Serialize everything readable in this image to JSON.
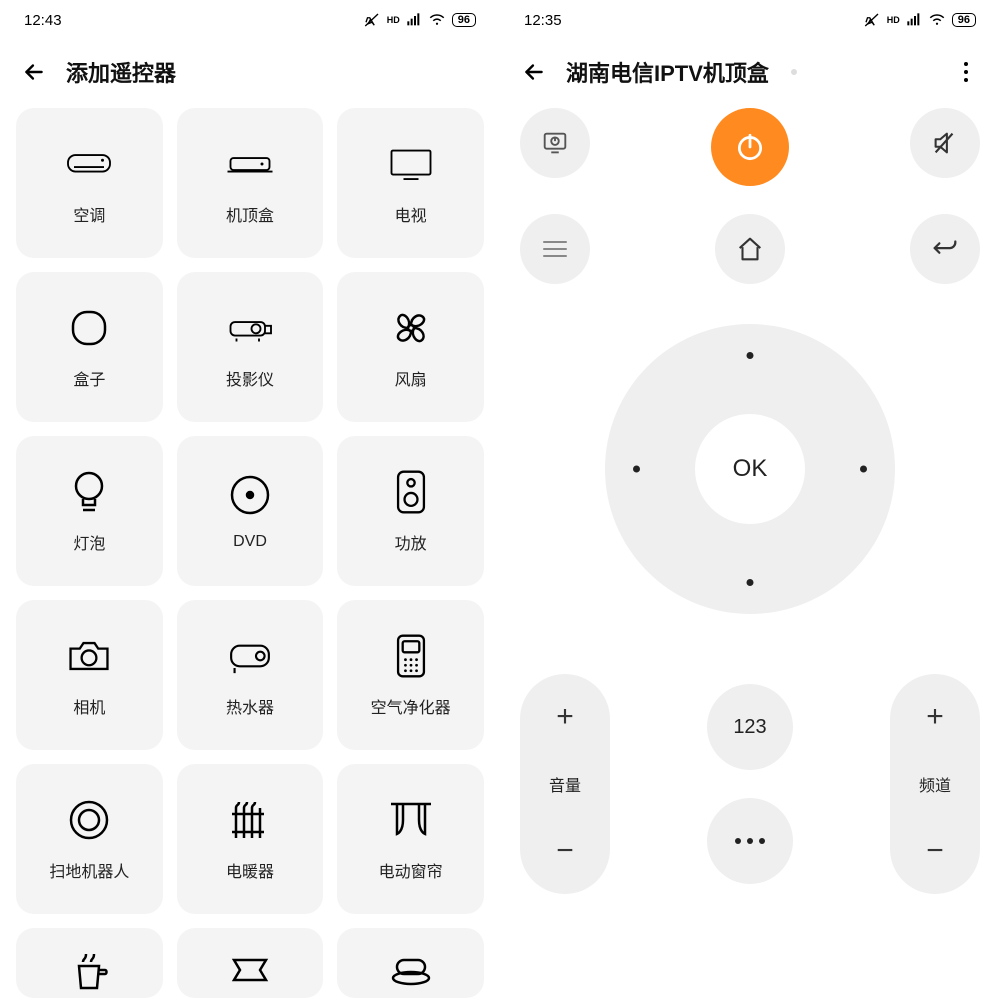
{
  "left": {
    "status": {
      "time": "12:43",
      "battery": "96"
    },
    "header": {
      "title": "添加遥控器"
    },
    "categories": [
      {
        "key": "ac",
        "label": "空调"
      },
      {
        "key": "stb",
        "label": "机顶盒"
      },
      {
        "key": "tv",
        "label": "电视"
      },
      {
        "key": "box",
        "label": "盒子"
      },
      {
        "key": "projector",
        "label": "投影仪"
      },
      {
        "key": "fan",
        "label": "风扇"
      },
      {
        "key": "bulb",
        "label": "灯泡"
      },
      {
        "key": "dvd",
        "label": "DVD"
      },
      {
        "key": "amplifier",
        "label": "功放"
      },
      {
        "key": "camera",
        "label": "相机"
      },
      {
        "key": "heater",
        "label": "热水器"
      },
      {
        "key": "purifier",
        "label": "空气净化器"
      },
      {
        "key": "robot",
        "label": "扫地机器人"
      },
      {
        "key": "radiator",
        "label": "电暖器"
      },
      {
        "key": "curtain",
        "label": "电动窗帘"
      }
    ]
  },
  "right": {
    "status": {
      "time": "12:35",
      "battery": "96"
    },
    "header": {
      "title": "湖南电信IPTV机顶盒"
    },
    "buttons": {
      "dpad_ok": "OK",
      "keypad_label": "123",
      "volume_label": "音量",
      "channel_label": "频道"
    }
  }
}
